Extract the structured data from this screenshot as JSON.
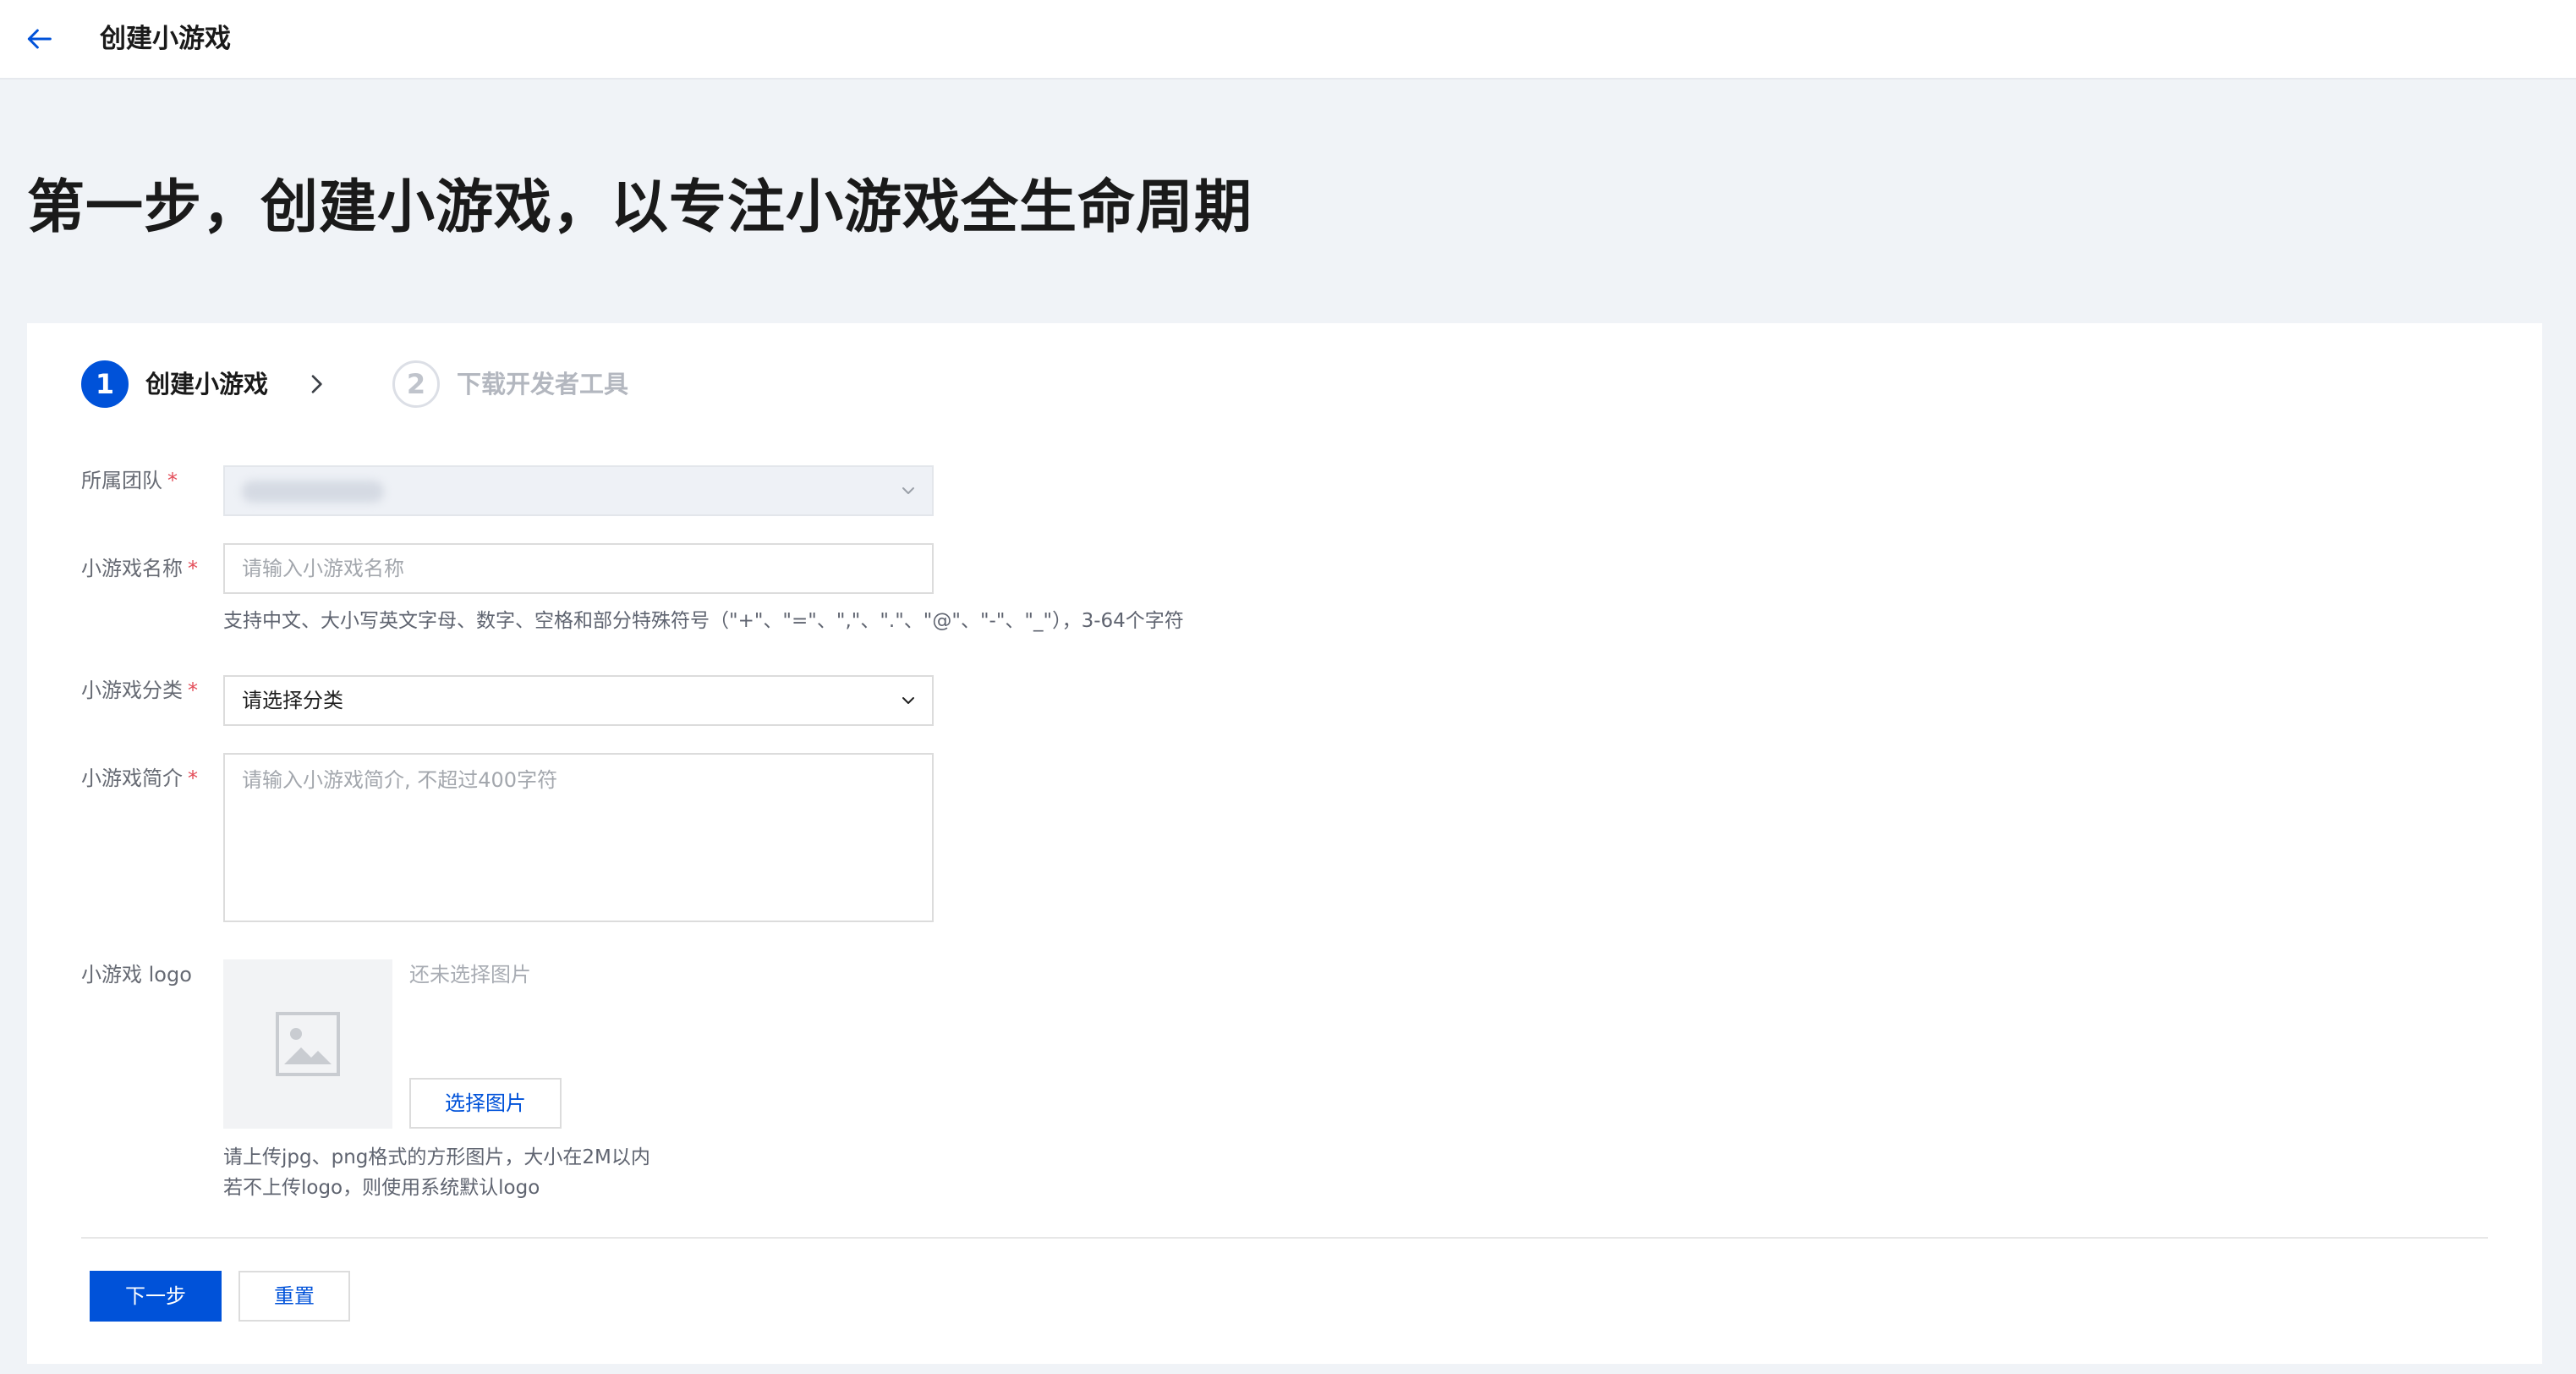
{
  "header": {
    "title": "创建小游戏"
  },
  "headline": "第一步，创建小游戏，以专注小游戏全生命周期",
  "steps": [
    {
      "number": "1",
      "label": "创建小游戏",
      "state": "active"
    },
    {
      "number": "2",
      "label": "下载开发者工具",
      "state": "inactive"
    }
  ],
  "form": {
    "team": {
      "label": "所属团队",
      "required": "*"
    },
    "name": {
      "label": "小游戏名称",
      "required": "*",
      "placeholder": "请输入小游戏名称",
      "hint": "支持中文、大小写英文字母、数字、空格和部分特殊符号（\"+\"、\"=\"、\",\"、\".\"、\"@\"、\"-\"、\"_\"），3-64个字符"
    },
    "category": {
      "label": "小游戏分类",
      "required": "*",
      "value": "请选择分类"
    },
    "intro": {
      "label": "小游戏简介",
      "required": "*",
      "placeholder": "请输入小游戏简介, 不超过400字符"
    },
    "logo": {
      "label": "小游戏 logo",
      "no_image_text": "还未选择图片",
      "choose_button": "选择图片",
      "hint_line1": "请上传jpg、png格式的方形图片，大小在2M以内",
      "hint_line2": "若不上传logo，则使用系统默认logo"
    }
  },
  "actions": {
    "next": "下一步",
    "reset": "重置"
  },
  "colors": {
    "primary": "#0052d9",
    "required": "#e34d59",
    "background": "#f0f3f7"
  },
  "icons": {
    "back": "arrow-left-icon",
    "step_separator": "chevron-right-icon",
    "dropdown": "chevron-down-icon",
    "logo_placeholder": "image-placeholder-icon"
  }
}
